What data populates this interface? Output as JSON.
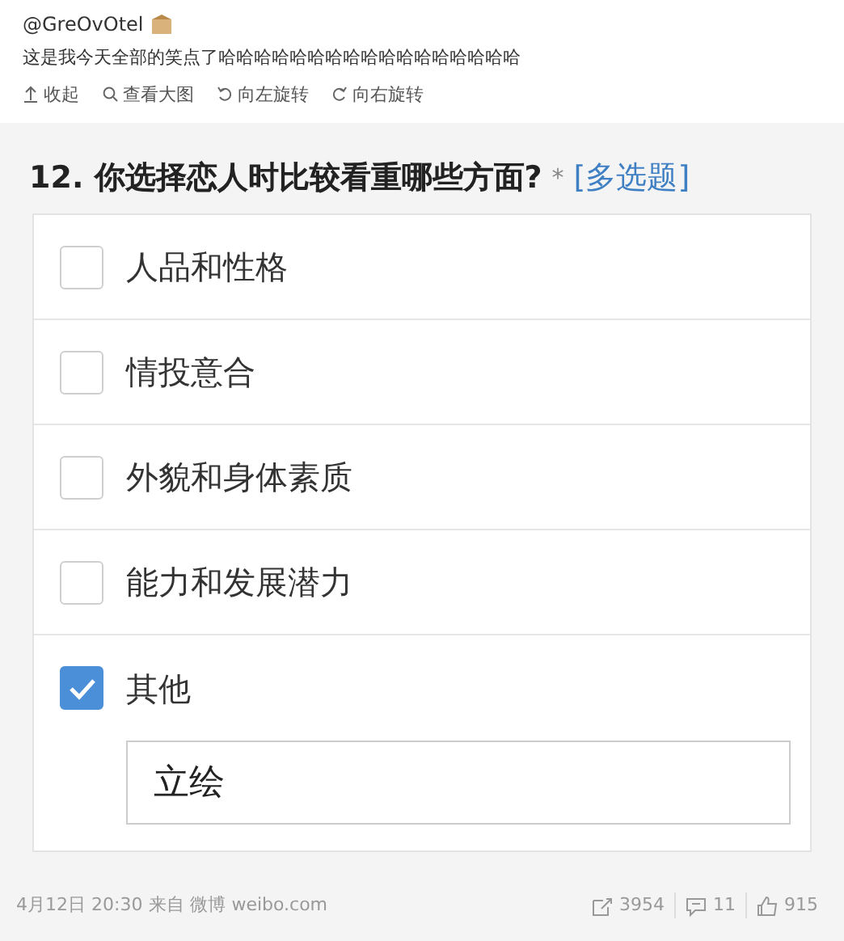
{
  "post": {
    "author": "@GreOvOtel",
    "text": "这是我今天全部的笑点了哈哈哈哈哈哈哈哈哈哈哈哈哈哈哈哈哈",
    "actions": [
      {
        "kind": "collapse",
        "label": "收起"
      },
      {
        "kind": "zoom",
        "label": "查看大图"
      },
      {
        "kind": "rotate-left",
        "label": "向左旋转"
      },
      {
        "kind": "rotate-right",
        "label": "向右旋转"
      }
    ]
  },
  "question": {
    "title": "12. 你选择恋人时比较看重哪些方面?",
    "required": "*",
    "type": "[多选题]",
    "options": [
      {
        "label": "人品和性格",
        "checked": false
      },
      {
        "label": "情投意合",
        "checked": false
      },
      {
        "label": "外貌和身体素质",
        "checked": false
      },
      {
        "label": "能力和发展潜力",
        "checked": false
      },
      {
        "label": "其他",
        "checked": true
      }
    ],
    "other_value": "立绘"
  },
  "footer": {
    "time": "4月12日 20:30",
    "source": "来自 微博 weibo.com",
    "stats": [
      {
        "kind": "repost",
        "count": "3954"
      },
      {
        "kind": "comment",
        "count": "11"
      },
      {
        "kind": "like",
        "count": "915"
      }
    ]
  }
}
